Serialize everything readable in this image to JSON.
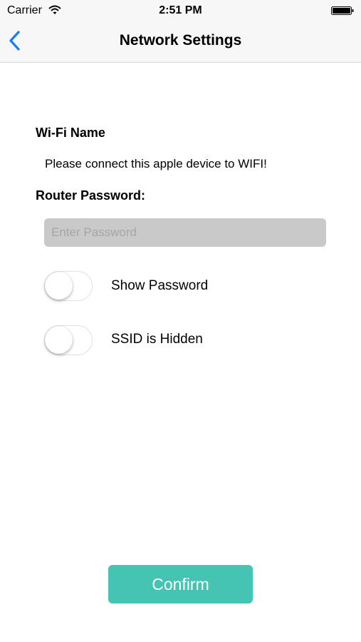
{
  "status_bar": {
    "carrier": "Carrier",
    "time": "2:51 PM",
    "wifi_icon": "wifi-icon",
    "battery_icon": "battery-icon"
  },
  "nav": {
    "back_icon": "chevron-left-icon",
    "title": "Network Settings",
    "accent_color": "#1a7cf5"
  },
  "wifi": {
    "label": "Wi-Fi Name",
    "value": "Please connect this apple device to WIFI!"
  },
  "router": {
    "label": "Router Password:",
    "placeholder": "Enter Password",
    "value": ""
  },
  "toggles": {
    "show_password": {
      "label": "Show Password",
      "on": false
    },
    "ssid_hidden": {
      "label": "SSID is Hidden",
      "on": false
    }
  },
  "confirm": {
    "label": "Confirm",
    "color": "#45c3b3"
  }
}
